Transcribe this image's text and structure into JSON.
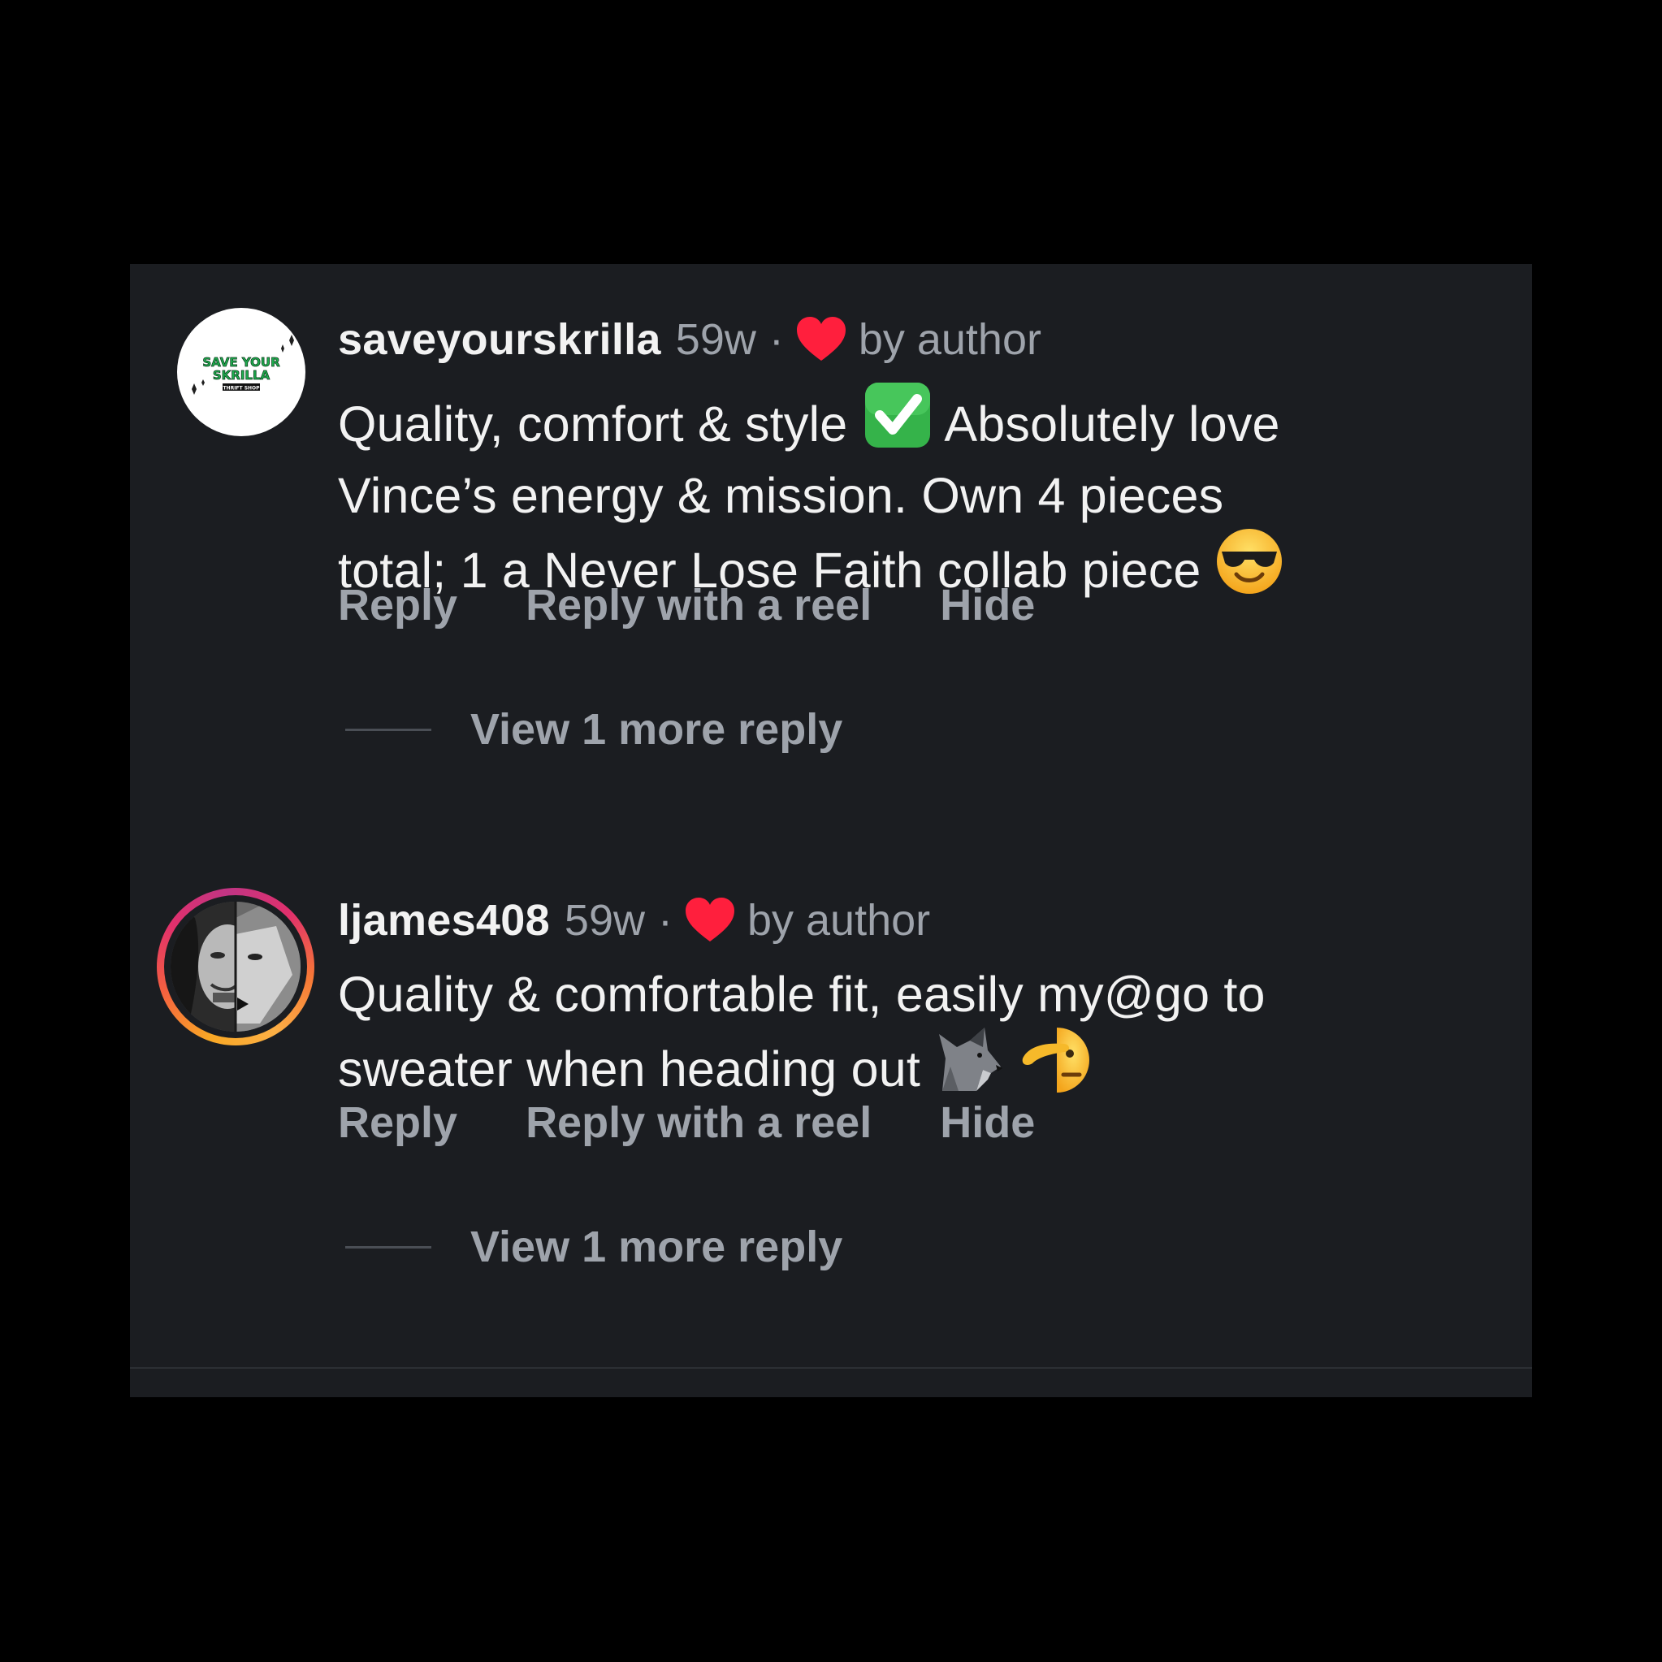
{
  "colors": {
    "background": "#000000",
    "panel": "#1b1d21",
    "text_primary": "#f2f2f2",
    "text_secondary": "#9ea3ab",
    "heart": "#ff3040"
  },
  "comments": [
    {
      "username": "saveyourskrilla",
      "time": "59w",
      "separator": "·",
      "liked_label": "by author",
      "avatar_icon": "save-your-skrilla-logo",
      "avatar_text": [
        "SAVE YOUR",
        "SKRILLA",
        "THRIFT SHOP"
      ],
      "body_lines": [
        "Quality, comfort & style",
        "Absolutely love",
        "Vince’s energy & mission. Own 4 pieces",
        "total; 1 a Never Lose Faith collab piece"
      ],
      "emojis": [
        "check-mark-button",
        "smiling-face-with-sunglasses"
      ],
      "actions": [
        "Reply",
        "Reply with a reel",
        "Hide"
      ],
      "view_more": "View 1 more reply"
    },
    {
      "username": "ljames408",
      "time": "59w",
      "separator": "·",
      "liked_label": "by author",
      "avatar_icon": "face-wolf-portrait",
      "body_lines": [
        "Quality & comfortable fit, easily my@go to",
        "sweater when heading out"
      ],
      "emojis": [
        "wolf",
        "saluting-face"
      ],
      "actions": [
        "Reply",
        "Reply with a reel",
        "Hide"
      ],
      "view_more": "View 1 more reply"
    }
  ]
}
